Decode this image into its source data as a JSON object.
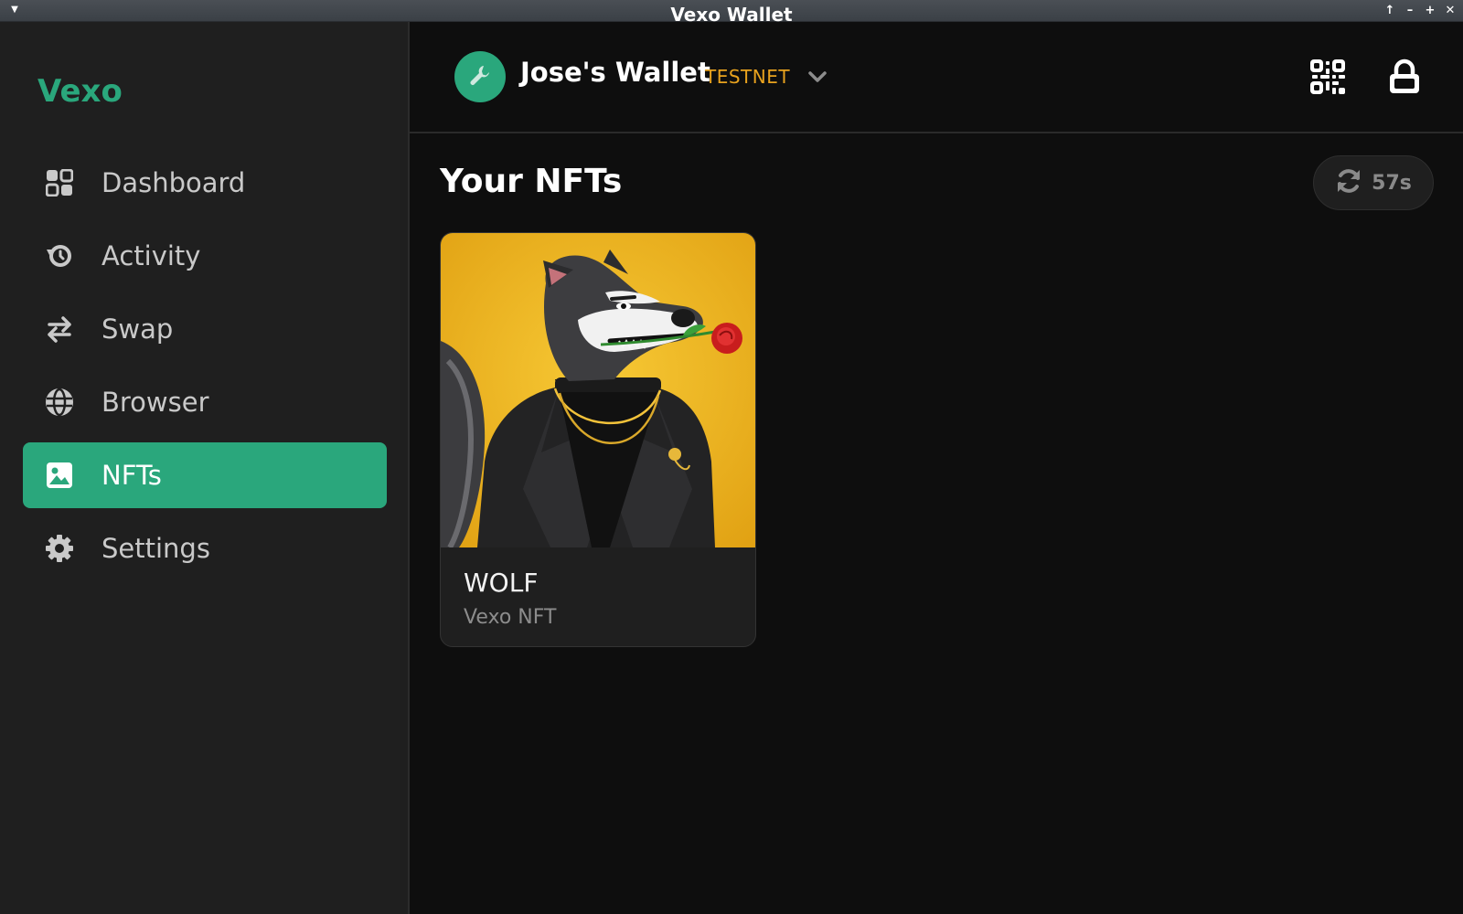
{
  "window": {
    "title": "Vexo Wallet"
  },
  "sidebar": {
    "brand": "Vexo",
    "items": [
      {
        "label": "Dashboard",
        "icon": "dashboard-icon",
        "active": false
      },
      {
        "label": "Activity",
        "icon": "history-icon",
        "active": false
      },
      {
        "label": "Swap",
        "icon": "swap-arrows-icon",
        "active": false
      },
      {
        "label": "Browser",
        "icon": "globe-icon",
        "active": false
      },
      {
        "label": "NFTs",
        "icon": "image-icon",
        "active": true
      },
      {
        "label": "Settings",
        "icon": "gear-icon",
        "active": false
      }
    ]
  },
  "header": {
    "wallet_name": "Jose's Wallet",
    "network": "TESTNET",
    "avatar_icon": "wrench-icon"
  },
  "main": {
    "title": "Your NFTs",
    "refresh_countdown": "57s",
    "nfts": [
      {
        "name": "WOLF",
        "collection": "Vexo NFT"
      }
    ]
  },
  "colors": {
    "accent": "#2aa77c",
    "network": "#e8a21e",
    "sidebar_bg": "#1f1f1f",
    "main_bg": "#0e0e0e"
  }
}
